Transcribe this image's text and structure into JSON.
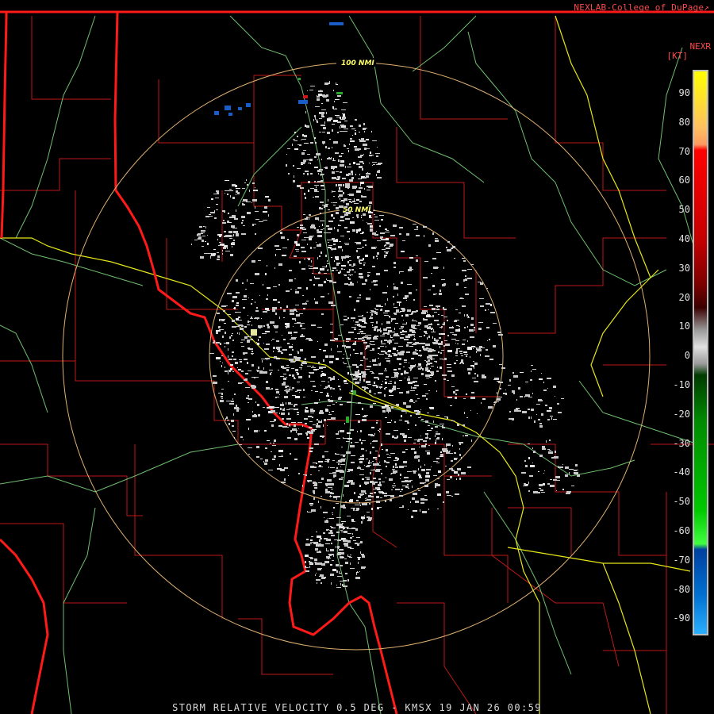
{
  "header": {
    "credit": "NEXLAB-College of DuPage",
    "credit_icon": "external-link-icon",
    "product_code": "NEXR",
    "unit_label": "[KT]"
  },
  "footer": {
    "caption": "STORM RELATIVE VELOCITY 0.5 DEG - KMSX 19 JAN 26 00:59"
  },
  "range_rings": [
    {
      "label": "100 NMI"
    },
    {
      "label": "50 NMI"
    }
  ],
  "legend": {
    "ticks": [
      "90",
      "80",
      "70",
      "60",
      "50",
      "40",
      "30",
      "20",
      "10",
      "0",
      "-10",
      "-20",
      "-30",
      "-40",
      "-50",
      "-60",
      "-70",
      "-80",
      "-90"
    ]
  },
  "colors": {
    "state_border": "#ff1a1a",
    "county_border": "#c01818",
    "highway": "#e6e619",
    "river": "#6fbf6f",
    "range_ring": "#e0b070",
    "clutter": "#c8c8c8",
    "inbound": "#1a5cc8",
    "outbound": "#c81a1a"
  }
}
